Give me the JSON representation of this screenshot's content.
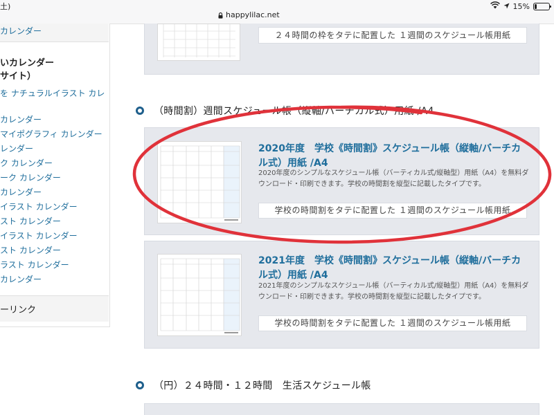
{
  "status_bar": {
    "time_fragment": "土)",
    "url": "happylilac.net",
    "battery_percent": "15%",
    "battery_level": 0.15
  },
  "sidebar": {
    "top_link": "カレンダー",
    "heading": "いカレンダー\nサイト）",
    "links": [
      "を ナチュラルイラスト カレ",
      "カレンダー",
      "マイポグラフィ カレンダー",
      "レンダー",
      "ク カレンダー",
      "ーク カレンダー",
      "カレンダー",
      "イラスト カレンダー",
      "スト カレンダー",
      "イラスト カレンダー",
      "スト カレンダー",
      "ラスト カレンダー",
      "カレンダー"
    ],
    "bottom_label": "ーリンク"
  },
  "top_card": {
    "button_label": "２４時間の枠をタテに配置した １週間のスケジュール帳用紙"
  },
  "section1": {
    "title": "（時間割）週間スケジュール帳（縦軸/バーチカル式）用紙 /A4"
  },
  "cards": [
    {
      "title": "2020年度　学校《時間割》スケジュール帳（縦軸/バーチカル式）用紙 /A4",
      "description": "2020年度のシンプルなスケジュール帳（バーティカル式/縦軸型）用紙（A4）を無料ダウンロード・印刷できます。学校の時間割を縦型に記載したタイプです。",
      "button_label": "学校の時間割をタテに配置した １週間のスケジュール帳用紙"
    },
    {
      "title": "2021年度　学校《時間割》スケジュール帳（縦軸/バーチカル式）用紙 /A4",
      "description": "2021年度のシンプルなスケジュール帳（バーティカル式/縦軸型）用紙（A4）を無料ダウンロード・印刷できます。学校の時間割を縦型に記載したタイプです。",
      "button_label": "学校の時間割をタテに配置した １週間のスケジュール帳用紙"
    }
  ],
  "section2": {
    "title": "（円）２４時間・１２時間　生活スケジュール帳"
  },
  "colors": {
    "link": "#1f6e9c",
    "card_bg": "#e6e8ed",
    "annotation_red": "#e0323a",
    "bullet": "#1e5f8c"
  },
  "icons": [
    "lock-icon",
    "wifi-icon",
    "location-icon",
    "battery-icon",
    "bullet-icon"
  ]
}
